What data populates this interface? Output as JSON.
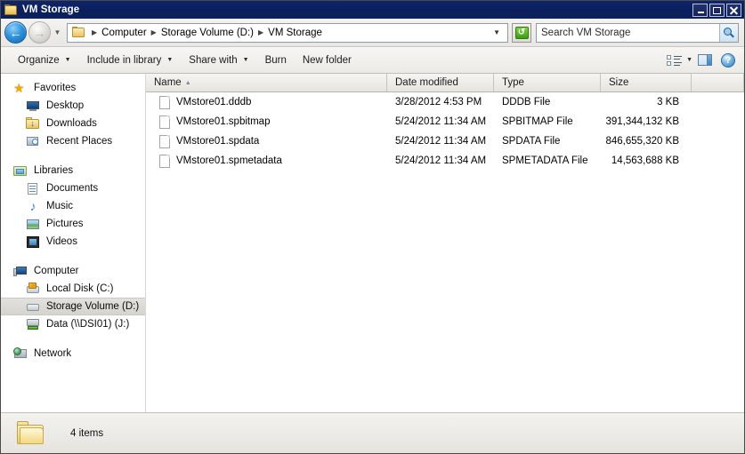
{
  "window": {
    "title": "VM Storage",
    "controls": {
      "minimize": "Minimize",
      "maximize": "Maximize",
      "close": "Close"
    }
  },
  "address_bar": {
    "back": "Back",
    "forward": "Forward",
    "recent_pages": "Recent Pages",
    "breadcrumbs": [
      "Computer",
      "Storage Volume (D:)",
      "VM Storage"
    ],
    "refresh": "Refresh",
    "dropdown": "Previous Locations"
  },
  "search": {
    "placeholder": "Search VM Storage",
    "value": "Search VM Storage",
    "button": "Search"
  },
  "toolbar": {
    "items": [
      {
        "label": "Organize",
        "has_caret": true
      },
      {
        "label": "Include in library",
        "has_caret": true
      },
      {
        "label": "Share with",
        "has_caret": true
      },
      {
        "label": "Burn",
        "has_caret": false
      },
      {
        "label": "New folder",
        "has_caret": false
      }
    ],
    "view_button": "Change your view",
    "view_caret": "More options",
    "preview_pane": "Show the preview pane",
    "help": "Help",
    "help_glyph": "?"
  },
  "sidebar": {
    "groups": [
      {
        "header": {
          "label": "Favorites",
          "icon": "star-icon"
        },
        "items": [
          {
            "label": "Desktop",
            "icon": "desktop-icon",
            "selected": false
          },
          {
            "label": "Downloads",
            "icon": "downloads-icon",
            "selected": false
          },
          {
            "label": "Recent Places",
            "icon": "recent-places-icon",
            "selected": false
          }
        ]
      },
      {
        "header": {
          "label": "Libraries",
          "icon": "libraries-icon"
        },
        "items": [
          {
            "label": "Documents",
            "icon": "documents-icon",
            "selected": false
          },
          {
            "label": "Music",
            "icon": "music-icon",
            "selected": false
          },
          {
            "label": "Pictures",
            "icon": "pictures-icon",
            "selected": false
          },
          {
            "label": "Videos",
            "icon": "videos-icon",
            "selected": false
          }
        ]
      },
      {
        "header": {
          "label": "Computer",
          "icon": "computer-icon"
        },
        "items": [
          {
            "label": "Local Disk (C:)",
            "icon": "local-disk-icon",
            "selected": false
          },
          {
            "label": "Storage Volume (D:)",
            "icon": "drive-icon",
            "selected": true
          },
          {
            "label": "Data (\\\\DSI01) (J:)",
            "icon": "network-drive-icon",
            "selected": false
          }
        ]
      },
      {
        "header": {
          "label": "Network",
          "icon": "network-icon"
        },
        "items": []
      }
    ]
  },
  "file_list": {
    "columns": [
      {
        "label": "Name",
        "sorted": true,
        "sort_direction": "ascending",
        "sort_glyph": "▲"
      },
      {
        "label": "Date modified",
        "sorted": false
      },
      {
        "label": "Type",
        "sorted": false
      },
      {
        "label": "Size",
        "sorted": false
      },
      {
        "label": "",
        "sorted": false
      }
    ],
    "rows": [
      {
        "name": "VMstore01.dddb",
        "date_modified": "3/28/2012 4:53 PM",
        "type": "DDDB File",
        "size": "3 KB",
        "icon": "file-icon"
      },
      {
        "name": "VMstore01.spbitmap",
        "date_modified": "5/24/2012 11:34 AM",
        "type": "SPBITMAP File",
        "size": "391,344,132 KB",
        "icon": "file-icon"
      },
      {
        "name": "VMstore01.spdata",
        "date_modified": "5/24/2012 11:34 AM",
        "type": "SPDATA File",
        "size": "846,655,320 KB",
        "icon": "file-icon"
      },
      {
        "name": "VMstore01.spmetadata",
        "date_modified": "5/24/2012 11:34 AM",
        "type": "SPMETADATA File",
        "size": "14,563,688 KB",
        "icon": "file-icon"
      }
    ]
  },
  "status_bar": {
    "item_count": "4 items",
    "folder_icon": "folder-icon"
  },
  "colors": {
    "title_bar": "#0c2160",
    "selection": "#dedcd7",
    "toolbar": "#f2f0ec",
    "accent_blue": "#2f93de",
    "refresh_green": "#3d9a16"
  }
}
